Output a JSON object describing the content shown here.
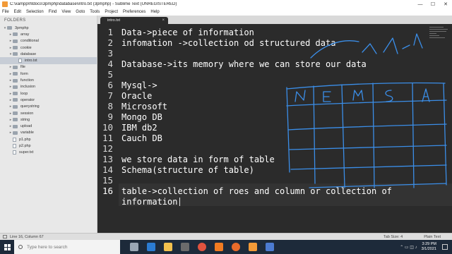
{
  "window": {
    "title": "C:\\xampp\\htdocs\\3pmphp\\database\\intro.txt (3pmphp) - Sublime Text (UNREGISTERED)",
    "minimize": "—",
    "maximize": "☐",
    "close": "✕"
  },
  "menu": [
    "File",
    "Edit",
    "Selection",
    "Find",
    "View",
    "Goto",
    "Tools",
    "Project",
    "Preferences",
    "Help"
  ],
  "sidebar": {
    "heading": "FOLDERS",
    "items": [
      {
        "label": "3pmphp",
        "kind": "folder",
        "depth": 0,
        "open": true
      },
      {
        "label": "array",
        "kind": "folder",
        "depth": 1
      },
      {
        "label": "conditional",
        "kind": "folder",
        "depth": 1
      },
      {
        "label": "cookie",
        "kind": "folder",
        "depth": 1
      },
      {
        "label": "database",
        "kind": "folder",
        "depth": 1,
        "open": true
      },
      {
        "label": "intro.txt",
        "kind": "file",
        "depth": 2,
        "selected": true
      },
      {
        "label": "file",
        "kind": "folder",
        "depth": 1
      },
      {
        "label": "form",
        "kind": "folder",
        "depth": 1
      },
      {
        "label": "function",
        "kind": "folder",
        "depth": 1
      },
      {
        "label": "inclusion",
        "kind": "folder",
        "depth": 1
      },
      {
        "label": "loop",
        "kind": "folder",
        "depth": 1
      },
      {
        "label": "operator",
        "kind": "folder",
        "depth": 1
      },
      {
        "label": "querystring",
        "kind": "folder",
        "depth": 1
      },
      {
        "label": "session",
        "kind": "folder",
        "depth": 1
      },
      {
        "label": "string",
        "kind": "folder",
        "depth": 1
      },
      {
        "label": "upload",
        "kind": "folder",
        "depth": 1
      },
      {
        "label": "variable",
        "kind": "folder",
        "depth": 1
      },
      {
        "label": "p1.php",
        "kind": "file",
        "depth": 1
      },
      {
        "label": "p2.php",
        "kind": "file",
        "depth": 1
      },
      {
        "label": "super.txt",
        "kind": "file",
        "depth": 1
      }
    ]
  },
  "tab": {
    "label": "intro.txt",
    "close": "×"
  },
  "editor": {
    "lines": [
      {
        "n": "1",
        "text": "Data->piece of information"
      },
      {
        "n": "2",
        "text": "infomation ->collection od structured data"
      },
      {
        "n": "3",
        "text": ""
      },
      {
        "n": "4",
        "text": "Database->its memory where we can store our data"
      },
      {
        "n": "5",
        "text": ""
      },
      {
        "n": "6",
        "text": "Mysql->"
      },
      {
        "n": "7",
        "text": "Oracle"
      },
      {
        "n": "8",
        "text": "Microsoft"
      },
      {
        "n": "9",
        "text": "Mongo DB"
      },
      {
        "n": "10",
        "text": "IBM db2"
      },
      {
        "n": "11",
        "text": "Cauch DB"
      },
      {
        "n": "12",
        "text": ""
      },
      {
        "n": "13",
        "text": "we store data in form of table"
      },
      {
        "n": "14",
        "text": "Schema(structure of table)"
      },
      {
        "n": "15",
        "text": ""
      },
      {
        "n": "16",
        "text": "table->collection of roes and column or collection of"
      },
      {
        "n": "",
        "text": "information"
      }
    ],
    "annotation": {
      "header_letters": [
        "N",
        "E",
        "M",
        "S",
        "A"
      ],
      "top_letters": [
        "c",
        "l",
        "f",
        "-",
        "n"
      ],
      "color": "#3b8ee8"
    }
  },
  "status": {
    "position": "Line 16, Column 67",
    "tab_size": "Tab Size: 4",
    "syntax": "Plain Text"
  },
  "taskbar": {
    "search_placeholder": "Type here to search",
    "icons": [
      "task-view",
      "edge",
      "file-explorer",
      "store",
      "chrome",
      "xampp",
      "firefox",
      "sublime",
      "media"
    ],
    "icon_colors": [
      "#9aa7b5",
      "#2b7cd3",
      "#f2c14e",
      "#6b6b6b",
      "#e0533f",
      "#f07b22",
      "#e86b2a",
      "#f29a38",
      "#4c7bd1"
    ],
    "tray_symbols": "⌃ ▭ ◫ ♪",
    "time": "3:29 PM",
    "date": "3/1/2021"
  }
}
